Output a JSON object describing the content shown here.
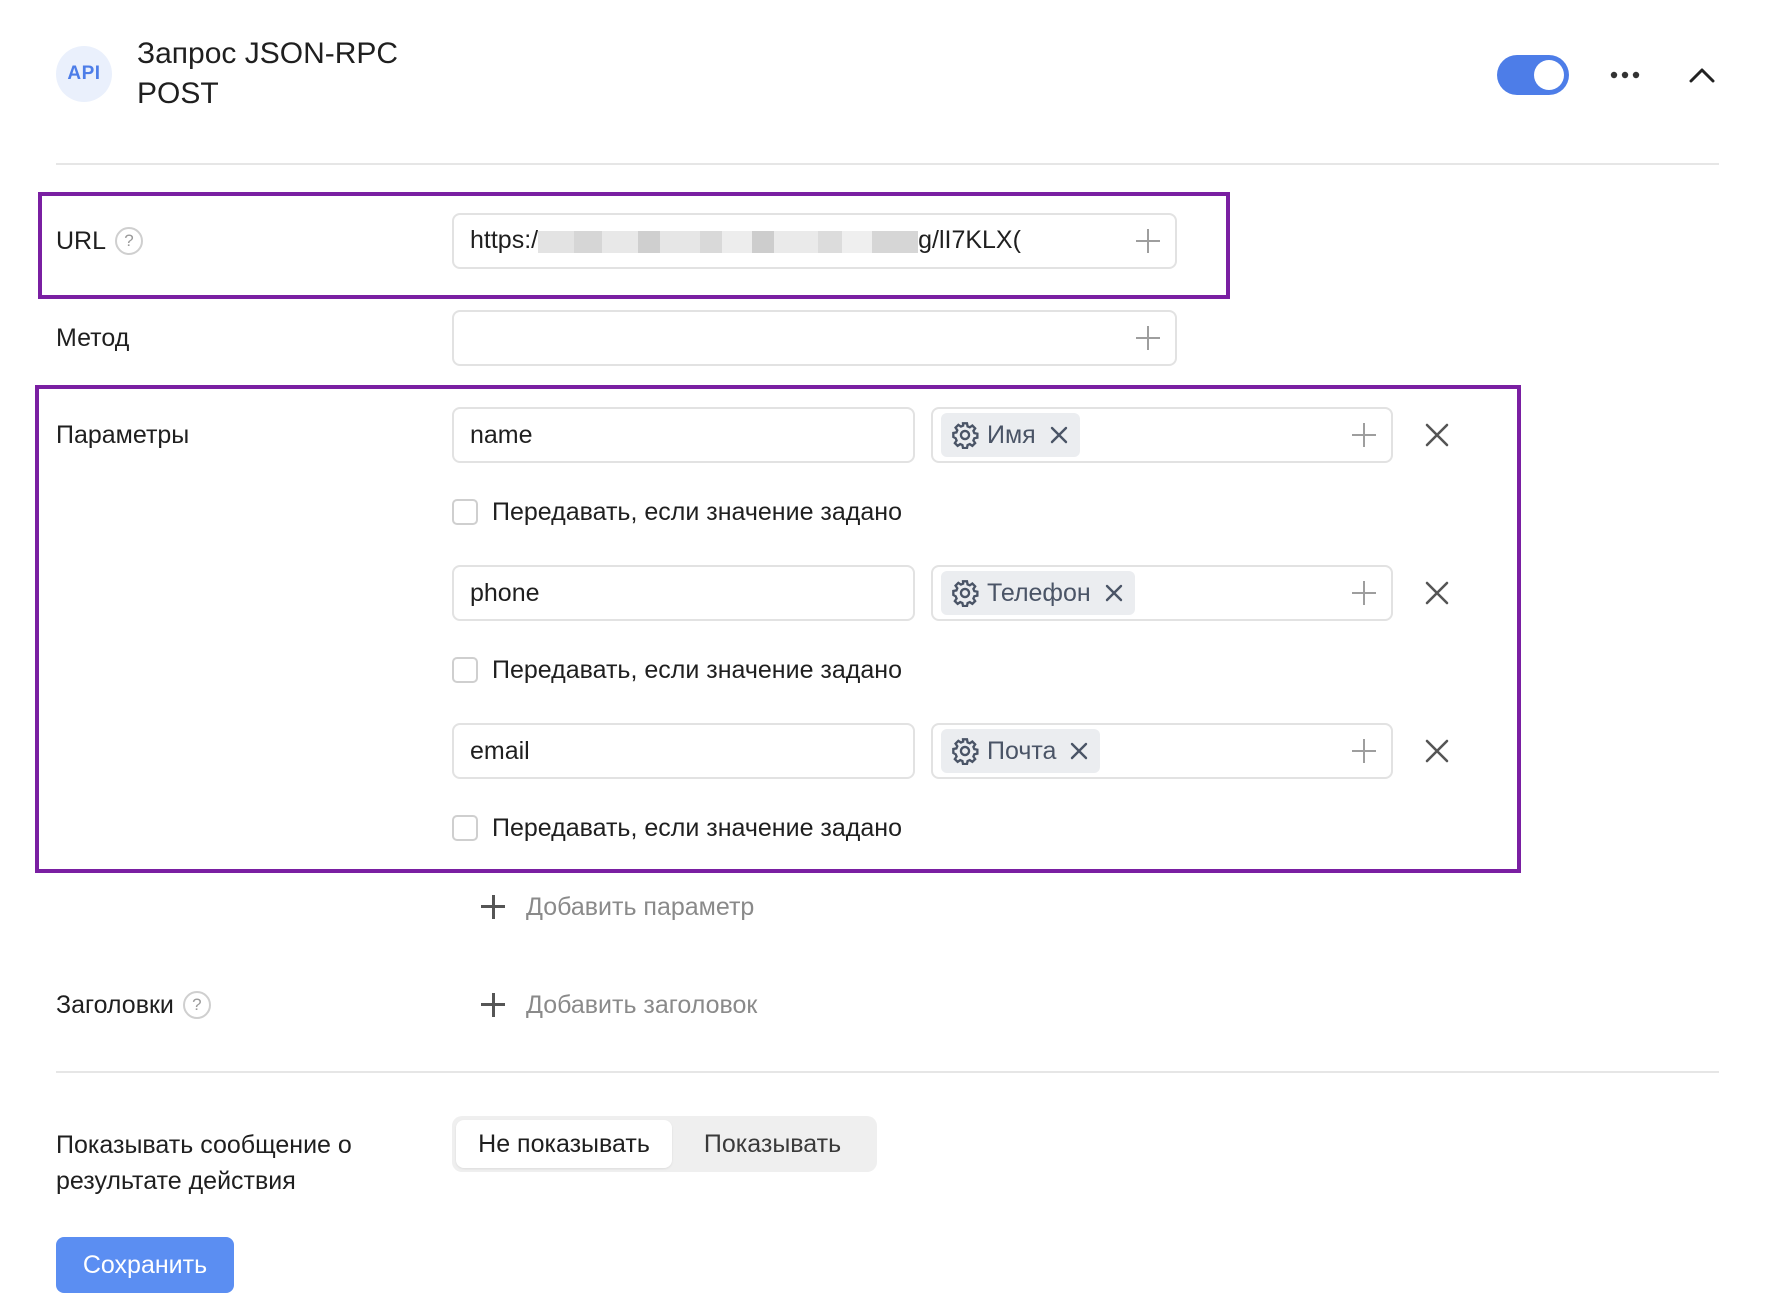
{
  "header": {
    "badge": "API",
    "title": "Запрос JSON-RPC POST",
    "toggle_on": true,
    "accent_color": "#4d7de8"
  },
  "url_row": {
    "label": "URL",
    "help": "?",
    "value_start": "https:/",
    "value_end": "g/lI7KLX("
  },
  "method_row": {
    "label": "Метод",
    "value": ""
  },
  "params": {
    "label": "Параметры",
    "items": [
      {
        "name": "name",
        "variable": "Имя",
        "checkbox_label": "Передавать, если значение задано",
        "checked": false
      },
      {
        "name": "phone",
        "variable": "Телефон",
        "checkbox_label": "Передавать, если значение задано",
        "checked": false
      },
      {
        "name": "email",
        "variable": "Почта",
        "checkbox_label": "Передавать, если значение задано",
        "checked": false
      }
    ],
    "add_label": "Добавить параметр"
  },
  "headers": {
    "label": "Заголовки",
    "help": "?",
    "add_label": "Добавить заголовок"
  },
  "result_message": {
    "label": "Показывать сообщение о результате действия",
    "options": [
      "Не показывать",
      "Показывать"
    ],
    "selected": "Не показывать"
  },
  "save_label": "Сохранить",
  "highlight_color": "#7a1fa2"
}
